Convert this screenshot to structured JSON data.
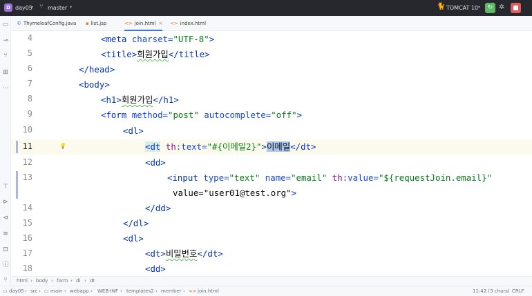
{
  "titlebar": {
    "project_badge": "D",
    "project_name": "day05",
    "branch_name": "master",
    "run_config": "TOMCAT 10"
  },
  "tabs": [
    {
      "label": "ThymeleafConfig.java",
      "icon": "java-class-icon"
    },
    {
      "label": "list.jsp",
      "icon": "jsp-file-icon"
    },
    {
      "label": "join.html",
      "icon": "html-file-icon",
      "active": true,
      "close": "×"
    },
    {
      "label": "index.html",
      "icon": "html-file-icon"
    }
  ],
  "editor": {
    "lines": [
      {
        "num": "4",
        "code": "<meta charset=\"UTF-8\">"
      },
      {
        "num": "5",
        "code": "<title>회원가입</title>"
      },
      {
        "num": "6",
        "code": "</head>"
      },
      {
        "num": "7",
        "code": "<body>"
      },
      {
        "num": "8",
        "code": "<h1>회원가입</h1>"
      },
      {
        "num": "9",
        "code": "<form method=\"post\" autocomplete=\"off\">"
      },
      {
        "num": "10",
        "code": "<dl>"
      },
      {
        "num": "11",
        "code": "<dt th:text=\"#{이메일2}\">이메일</dt>"
      },
      {
        "num": "12",
        "code": "<dd>"
      },
      {
        "num": "13",
        "code": "<input type=\"text\" name=\"email\" th:value=\"${requestJoin.email}\""
      },
      {
        "num": "",
        "code": "value=\"user01@test.org\">"
      },
      {
        "num": "14",
        "code": "</dd>"
      },
      {
        "num": "15",
        "code": "</dl>"
      },
      {
        "num": "16",
        "code": "<dl>"
      },
      {
        "num": "17",
        "code": "<dt>비밀번호</dt>"
      },
      {
        "num": "18",
        "code": "<dd>"
      }
    ]
  },
  "breadcrumb": [
    "html",
    "body",
    "form",
    "dl",
    "dt"
  ],
  "statusbar": {
    "path": [
      "day05",
      "src",
      "main",
      "webapp",
      "WEB-INF",
      "templates2",
      "member",
      "join.html"
    ],
    "cursor": "11:42 (3 chars)",
    "line_sep": "CRLF",
    "encoding": "UTF-8",
    "indent": "4 spaces"
  }
}
